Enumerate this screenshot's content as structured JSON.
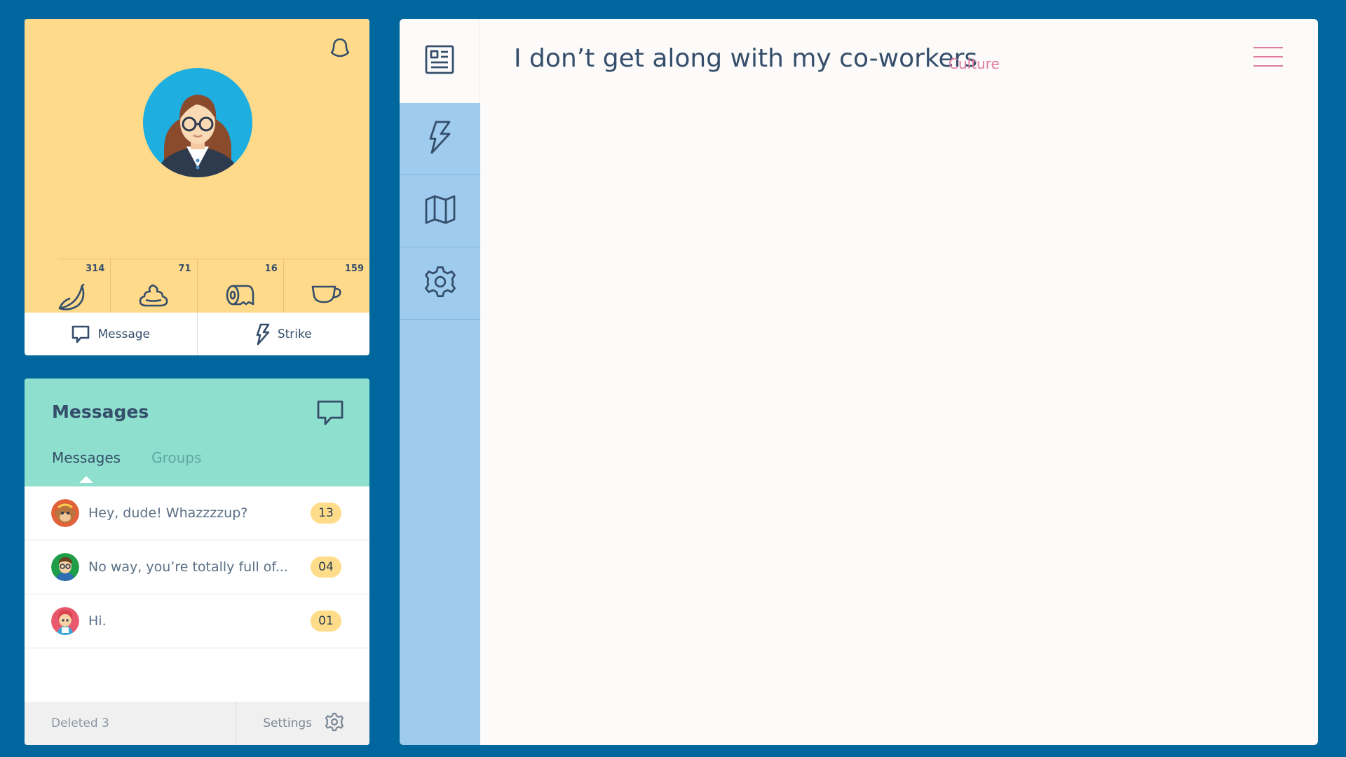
{
  "profile": {
    "stats": [
      {
        "icon": "banana-icon",
        "count": "314"
      },
      {
        "icon": "poop-icon",
        "count": "71"
      },
      {
        "icon": "toilet-paper-icon",
        "count": "16"
      },
      {
        "icon": "coffee-cup-icon",
        "count": "159"
      }
    ],
    "actions": {
      "message_label": "Message",
      "strike_label": "Strike"
    }
  },
  "messages": {
    "title": "Messages",
    "tabs": [
      {
        "label": "Messages",
        "active": true
      },
      {
        "label": "Groups",
        "active": false
      }
    ],
    "items": [
      {
        "text": "Hey, dude! Whazzzzup?",
        "badge": "13"
      },
      {
        "text": "No way, you’re totally full of...",
        "badge": "04"
      },
      {
        "text": "Hi.",
        "badge": "01"
      }
    ],
    "footer": {
      "deleted_label": "Deleted 3",
      "settings_label": "Settings"
    }
  },
  "nav": {
    "items": [
      "news-icon",
      "lightning-icon",
      "map-icon",
      "gear-icon"
    ]
  },
  "topic": {
    "title": "I don’t get along with my co-workers",
    "tag": "Culture"
  },
  "colors": {
    "background": "#00669e",
    "profile_yellow": "#ffda8a",
    "messages_mint": "#8edfcd",
    "nav_blue": "#9fcbee",
    "accent_pink": "#e07a9e",
    "text_navy": "#354e6b"
  }
}
